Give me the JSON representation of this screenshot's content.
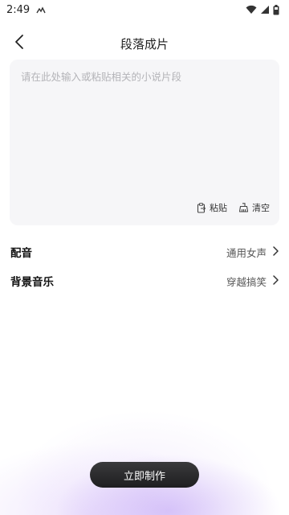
{
  "status_bar": {
    "time": "2:49",
    "icons": [
      "notification-icon",
      "wifi-icon",
      "signal-icon",
      "battery-icon"
    ]
  },
  "header": {
    "title": "段落成片",
    "back_icon": "chevron-left-icon"
  },
  "editor": {
    "value": "",
    "placeholder": "请在此处输入或粘贴相关的小说片段",
    "actions": {
      "paste_label": "粘贴",
      "clear_label": "清空"
    }
  },
  "settings": {
    "voice": {
      "label": "配音",
      "value": "通用女声"
    },
    "music": {
      "label": "背景音乐",
      "value": "穿越搞笑"
    }
  },
  "primary_button": {
    "label": "立即制作"
  },
  "colors": {
    "card_background": "#f6f6f8",
    "button_background": "#2a2a2c",
    "accent_glow": "#bea0f5"
  }
}
